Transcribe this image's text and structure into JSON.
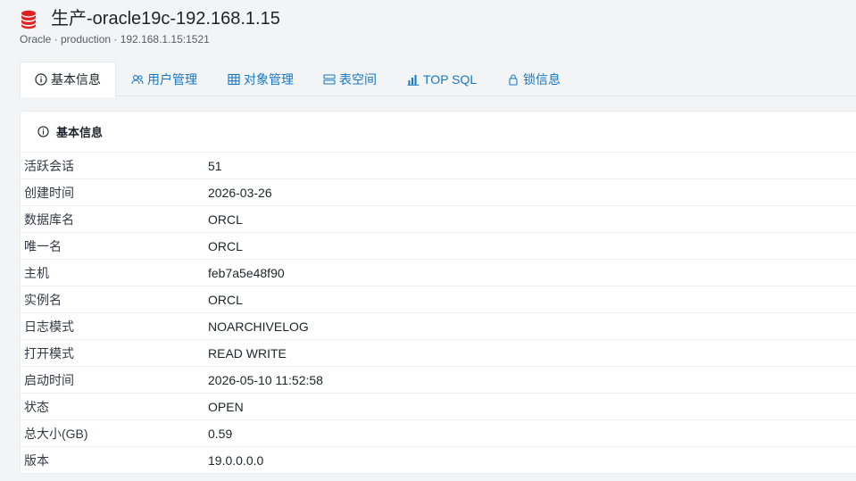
{
  "header": {
    "title": "生产-oracle19c-192.168.1.15",
    "subtitle": "Oracle · production · 192.168.1.15:1521",
    "icon": "database-icon",
    "icon_color": "#e02020"
  },
  "tabs": [
    {
      "label": "基本信息",
      "icon": "info-icon",
      "active": true
    },
    {
      "label": "用户管理",
      "icon": "users-icon",
      "active": false
    },
    {
      "label": "对象管理",
      "icon": "table-icon",
      "active": false
    },
    {
      "label": "表空间",
      "icon": "storage-icon",
      "active": false
    },
    {
      "label": "TOP SQL",
      "icon": "bar-chart-icon",
      "active": false
    },
    {
      "label": "锁信息",
      "icon": "lock-icon",
      "active": false
    }
  ],
  "card": {
    "title": "基本信息",
    "rows": [
      {
        "key": "活跃会话",
        "value": "51"
      },
      {
        "key": "创建时间",
        "value": "2026-03-26"
      },
      {
        "key": "数据库名",
        "value": "ORCL"
      },
      {
        "key": "唯一名",
        "value": "ORCL"
      },
      {
        "key": "主机",
        "value": "feb7a5e48f90"
      },
      {
        "key": "实例名",
        "value": "ORCL"
      },
      {
        "key": "日志模式",
        "value": "NOARCHIVELOG"
      },
      {
        "key": "打开模式",
        "value": "READ WRITE"
      },
      {
        "key": "启动时间",
        "value": "2026-05-10 11:52:58"
      },
      {
        "key": "状态",
        "value": "OPEN"
      },
      {
        "key": "总大小(GB)",
        "value": "0.59"
      },
      {
        "key": "版本",
        "value": "19.0.0.0.0"
      }
    ]
  },
  "colors": {
    "accent": "#1677c7",
    "text": "#1f2329",
    "border": "#e4e7ec"
  }
}
